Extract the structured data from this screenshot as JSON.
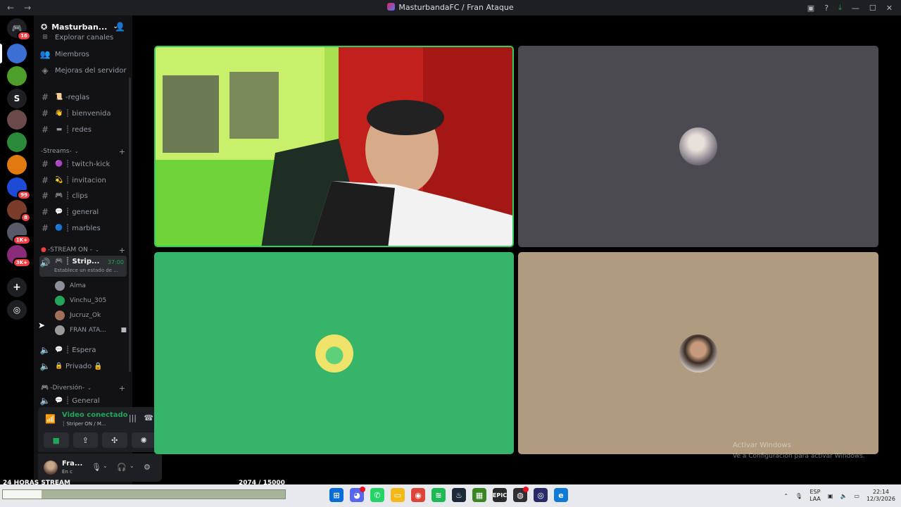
{
  "window": {
    "title": "MasturbandaFC / Fran Ataque",
    "back": "←",
    "forward": "→"
  },
  "rail": {
    "home_badge": "16",
    "servers": [
      {
        "name": "server-1",
        "color": "#3b6fd4",
        "badge": ""
      },
      {
        "name": "server-2",
        "color": "#4e9f2c",
        "badge": ""
      },
      {
        "name": "server-s",
        "color": "#1e1f22",
        "letter": "S",
        "badge": ""
      },
      {
        "name": "server-4",
        "color": "#6b4a4a",
        "badge": ""
      },
      {
        "name": "server-5",
        "color": "#2a8a3a",
        "badge": ""
      },
      {
        "name": "server-6",
        "color": "#e07a10",
        "badge": ""
      },
      {
        "name": "server-7",
        "color": "#1d4bd8",
        "badge": "99"
      },
      {
        "name": "server-8",
        "color": "#7a3b2b",
        "badge": "8"
      },
      {
        "name": "server-9",
        "color": "#555a66",
        "badge": "1K+"
      },
      {
        "name": "server-10",
        "color": "#8a2b7a",
        "badge": "3K+"
      }
    ]
  },
  "sidebar": {
    "server_name": "Masturban...",
    "top_items": [
      "Explorar canales",
      "Miembros",
      "Mejoras del servidor"
    ],
    "channels_top": [
      {
        "icon": "📜",
        "label": "-reglas"
      },
      {
        "icon": "👋",
        "label": "┊ bienvenida"
      },
      {
        "icon": "▬",
        "label": "┊ redes"
      }
    ],
    "cat_streams": "-Streams-",
    "channels_streams": [
      {
        "icon": "🟣",
        "label": "┊ twitch-kick"
      },
      {
        "icon": "💫",
        "label": "┊ invitacion"
      },
      {
        "icon": "🎮",
        "label": "┊ clips"
      },
      {
        "icon": "💬",
        "label": "┊ general"
      },
      {
        "icon": "🔵",
        "label": "┊ marbles"
      }
    ],
    "cat_stream_on": "-STREAM ON -",
    "active_voice": {
      "label": "┊ Strip...",
      "time": "37:00",
      "status": "Establece un estado de ..."
    },
    "members": [
      {
        "name": "Alma",
        "color": "#8a8f99"
      },
      {
        "name": "Vinchu_305",
        "color": "#23a55a"
      },
      {
        "name": "Jucruz_Ok",
        "color": "#a0705a"
      },
      {
        "name": "FRAN ATA...",
        "color": "#9a9a9a"
      }
    ],
    "voice_channels": [
      {
        "icon": "💬",
        "label": "┊ Espera"
      },
      {
        "icon": "🔒",
        "label": "Privado 🔒"
      }
    ],
    "cat_diversion": "-Diversión-",
    "channel_general": {
      "icon": "💬",
      "label": "┊ General"
    }
  },
  "voice_panel": {
    "state": "Video conectado",
    "channel": "┊ Striper ON / M..."
  },
  "user": {
    "name": "Fra...",
    "status": "En c"
  },
  "tiles": [
    {
      "name": "camera-tile",
      "bg": "#9bd84a"
    },
    {
      "name": "tile-2",
      "bg": "#4b4a50"
    },
    {
      "name": "tile-3",
      "bg": "#36b56a"
    },
    {
      "name": "tile-4",
      "bg": "#b09a80"
    }
  ],
  "watermark": {
    "line1": "Activar Windows",
    "line2": "Ve a Configuración para activar Windows."
  },
  "overlay": {
    "label": "24 HORAS STREAM",
    "count": "2074 / 15000",
    "progress": 0.138
  },
  "taskbar": {
    "lang1": "ESP",
    "lang2": "LAA",
    "time": "22:14",
    "date": "12/3/2026"
  }
}
